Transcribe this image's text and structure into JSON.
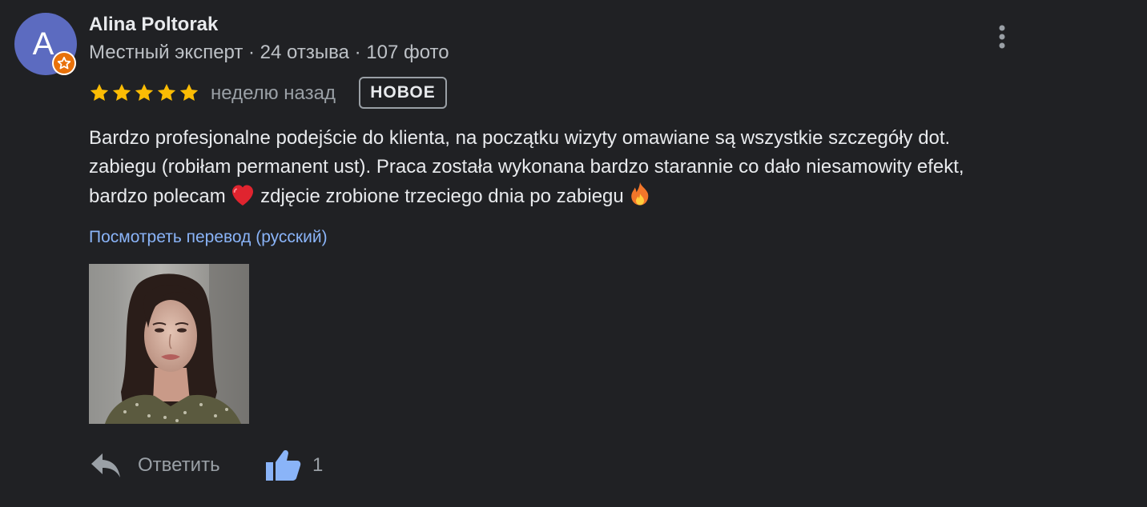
{
  "reviewer": {
    "avatar_letter": "A",
    "name": "Alina Poltorak",
    "meta": "Местный эксперт · 24 отзыва · 107 фото"
  },
  "review": {
    "rating": 5,
    "rating_max": 5,
    "time_ago": "неделю назад",
    "new_badge": "НОВОЕ",
    "text_line_1": "Bardzo profesjonalne podejście do klienta, na początku wizyty omawiane są wszystkie szczegóły dot.",
    "text_line_2": "zabiegu (robiłam permanent ust). Praca została wykonana bardzo starannie co dało niesamowity efekt,",
    "text_line_3a": "bardzo polecam",
    "text_line_3b": "zdjęcie zrobione trzeciego dnia po zabiegu",
    "translate_link": "Посмотреть перевод (русский)"
  },
  "actions": {
    "reply_label": "Ответить",
    "like_count": "1"
  },
  "colors": {
    "background": "#202124",
    "avatar": "#5c6bc0",
    "badge": "#e8710a",
    "star": "#fbbc04",
    "link": "#8ab4f8",
    "like_icon": "#8ab4f8"
  },
  "icons": {
    "avatar_badge": "local-guide-star-icon",
    "more": "more-vert-icon",
    "star": "star-icon",
    "heart": "red-heart-emoji",
    "fire": "fire-emoji",
    "reply": "reply-arrow-icon",
    "like": "thumbs-up-icon"
  }
}
